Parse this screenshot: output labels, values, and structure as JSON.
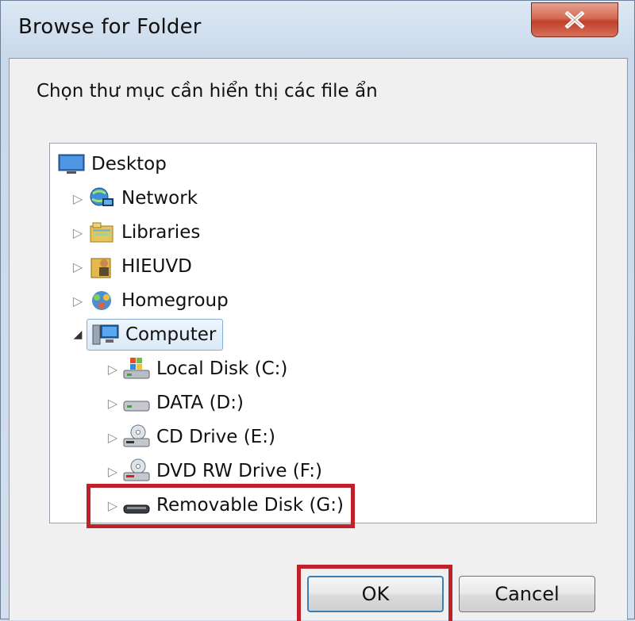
{
  "window": {
    "title": "Browse for Folder",
    "close_icon": "close-icon"
  },
  "dialog": {
    "description": "Chọn thư mục cần hiển thị các file ẩn"
  },
  "tree": {
    "items": [
      {
        "label": "Desktop",
        "icon": "desktop-icon",
        "expander": ""
      },
      {
        "label": "Network",
        "icon": "network-icon",
        "expander": "▷"
      },
      {
        "label": "Libraries",
        "icon": "libraries-icon",
        "expander": "▷"
      },
      {
        "label": "HIEUVD",
        "icon": "user-folder-icon",
        "expander": "▷"
      },
      {
        "label": "Homegroup",
        "icon": "homegroup-icon",
        "expander": "▷"
      },
      {
        "label": "Computer",
        "icon": "computer-icon",
        "expander": "◢",
        "selected": true
      },
      {
        "label": "Local Disk (C:)",
        "icon": "windows-drive-icon",
        "expander": "▷"
      },
      {
        "label": "DATA (D:)",
        "icon": "hard-drive-icon",
        "expander": "▷"
      },
      {
        "label": "CD Drive (E:)",
        "icon": "cd-drive-icon",
        "expander": "▷"
      },
      {
        "label": "DVD RW Drive (F:)",
        "icon": "dvd-drive-icon",
        "expander": "▷"
      },
      {
        "label": "Removable Disk (G:)",
        "icon": "usb-drive-icon",
        "expander": "▷",
        "highlighted": true
      }
    ]
  },
  "buttons": {
    "ok_label": "OK",
    "cancel_label": "Cancel"
  },
  "colors": {
    "highlight": "#c0202a",
    "selection_border": "#84acdd"
  }
}
